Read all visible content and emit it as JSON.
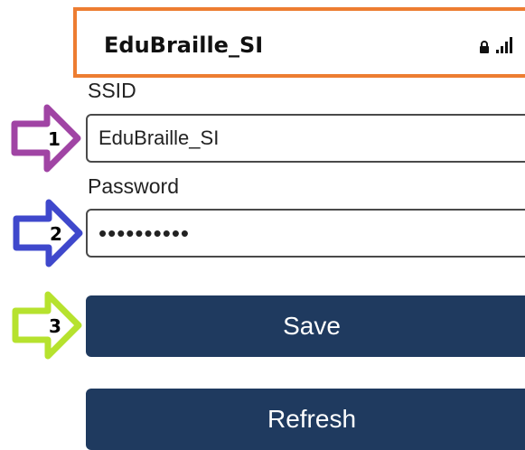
{
  "network": {
    "name": "EduBraille_SI",
    "secured": true,
    "signal": "full",
    "highlight_color": "#ED7D31"
  },
  "form": {
    "ssid_label": "SSID",
    "ssid_value": "EduBraille_SI",
    "password_label": "Password",
    "password_value": "••••••••••"
  },
  "buttons": {
    "save_label": "Save",
    "refresh_label": "Refresh",
    "color": "#1F3A5F"
  },
  "annotations": [
    {
      "number": "1",
      "target": "ssid-input",
      "color": "#A044A4"
    },
    {
      "number": "2",
      "target": "password-input",
      "color": "#3F48CC"
    },
    {
      "number": "3",
      "target": "save-button",
      "color": "#B6E22E"
    }
  ]
}
